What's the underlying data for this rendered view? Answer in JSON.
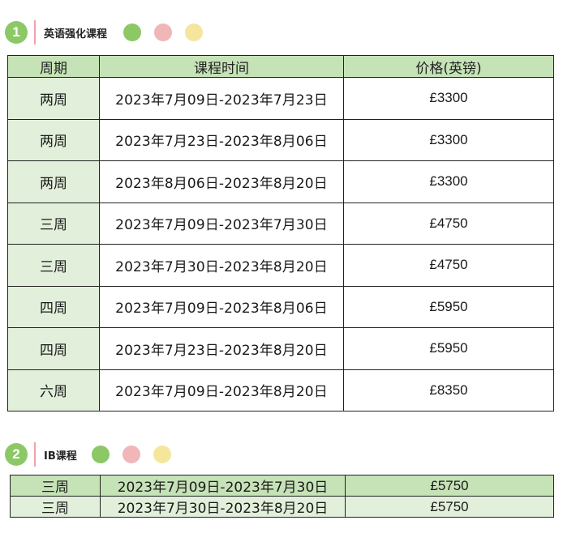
{
  "sections": [
    {
      "number": "1",
      "title": "英语强化课程",
      "colors": {
        "circle": "#8cc866",
        "accent": "#f0a3a8",
        "dots": [
          "#8cc866",
          "#f1b6b8",
          "#f4e79d"
        ]
      },
      "table": {
        "headers": [
          "周期",
          "课程时间",
          "价格(英镑)"
        ],
        "rows": [
          {
            "duration": "两周",
            "dates": "2023年7月09日-2023年7月23日",
            "price": "£3300"
          },
          {
            "duration": "两周",
            "dates": "2023年7月23日-2023年8月06日",
            "price": "£3300"
          },
          {
            "duration": "两周",
            "dates": "2023年8月06日-2023年8月20日",
            "price": "£3300"
          },
          {
            "duration": "三周",
            "dates": "2023年7月09日-2023年7月30日",
            "price": "£4750"
          },
          {
            "duration": "三周",
            "dates": "2023年7月30日-2023年8月20日",
            "price": "£4750"
          },
          {
            "duration": "四周",
            "dates": "2023年7月09日-2023年8月06日",
            "price": "£5950"
          },
          {
            "duration": "四周",
            "dates": "2023年7月23日-2023年8月20日",
            "price": "£5950"
          },
          {
            "duration": "六周",
            "dates": "2023年7月09日-2023年8月20日",
            "price": "£8350"
          }
        ]
      }
    },
    {
      "number": "2",
      "title": "IB课程",
      "colors": {
        "circle": "#8cc866",
        "accent": "#f0a3a8",
        "dots": [
          "#8cc866",
          "#f1b6b8",
          "#f4e79d"
        ]
      },
      "table": {
        "rows": [
          {
            "duration": "三周",
            "dates": "2023年7月09日-2023年7月30日",
            "price": "£5750"
          },
          {
            "duration": "三周",
            "dates": "2023年7月30日-2023年8月20日",
            "price": "£5750"
          }
        ]
      }
    }
  ]
}
